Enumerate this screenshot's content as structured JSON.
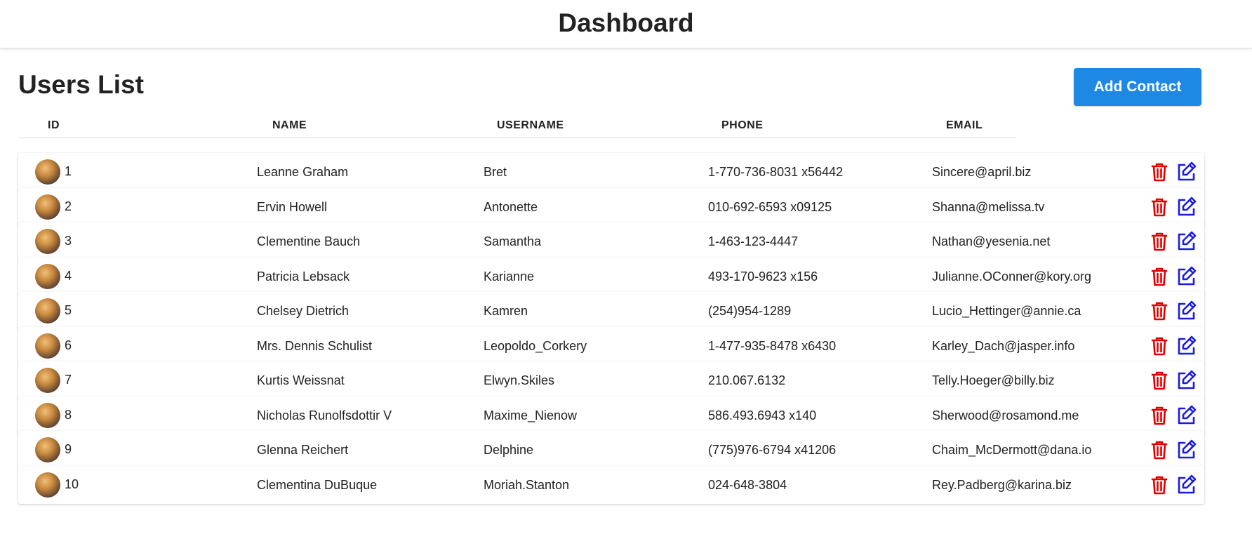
{
  "header": {
    "title": "Dashboard"
  },
  "page": {
    "title": "Users List",
    "add_button_label": "Add Contact"
  },
  "table": {
    "columns": [
      "ID",
      "NAME",
      "USERNAME",
      "PHONE",
      "EMAIL"
    ],
    "rows": [
      {
        "id": "1",
        "name": "Leanne Graham",
        "username": "Bret",
        "phone": "1-770-736-8031 x56442",
        "email": "Sincere@april.biz"
      },
      {
        "id": "2",
        "name": "Ervin Howell",
        "username": "Antonette",
        "phone": "010-692-6593 x09125",
        "email": "Shanna@melissa.tv"
      },
      {
        "id": "3",
        "name": "Clementine Bauch",
        "username": "Samantha",
        "phone": "1-463-123-4447",
        "email": "Nathan@yesenia.net"
      },
      {
        "id": "4",
        "name": "Patricia Lebsack",
        "username": "Karianne",
        "phone": "493-170-9623 x156",
        "email": "Julianne.OConner@kory.org"
      },
      {
        "id": "5",
        "name": "Chelsey Dietrich",
        "username": "Kamren",
        "phone": "(254)954-1289",
        "email": "Lucio_Hettinger@annie.ca"
      },
      {
        "id": "6",
        "name": "Mrs. Dennis Schulist",
        "username": "Leopoldo_Corkery",
        "phone": "1-477-935-8478 x6430",
        "email": "Karley_Dach@jasper.info"
      },
      {
        "id": "7",
        "name": "Kurtis Weissnat",
        "username": "Elwyn.Skiles",
        "phone": "210.067.6132",
        "email": "Telly.Hoeger@billy.biz"
      },
      {
        "id": "8",
        "name": "Nicholas Runolfsdottir V",
        "username": "Maxime_Nienow",
        "phone": "586.493.6943 x140",
        "email": "Sherwood@rosamond.me"
      },
      {
        "id": "9",
        "name": "Glenna Reichert",
        "username": "Delphine",
        "phone": "(775)976-6794 x41206",
        "email": "Chaim_McDermott@dana.io"
      },
      {
        "id": "10",
        "name": "Clementina DuBuque",
        "username": "Moriah.Stanton",
        "phone": "024-648-3804",
        "email": "Rey.Padberg@karina.biz"
      }
    ]
  },
  "icons": {
    "delete": "trash-icon",
    "edit": "edit-icon"
  },
  "colors": {
    "accent": "#1e88e5",
    "delete": "#e00000",
    "edit": "#1a1ae6"
  }
}
